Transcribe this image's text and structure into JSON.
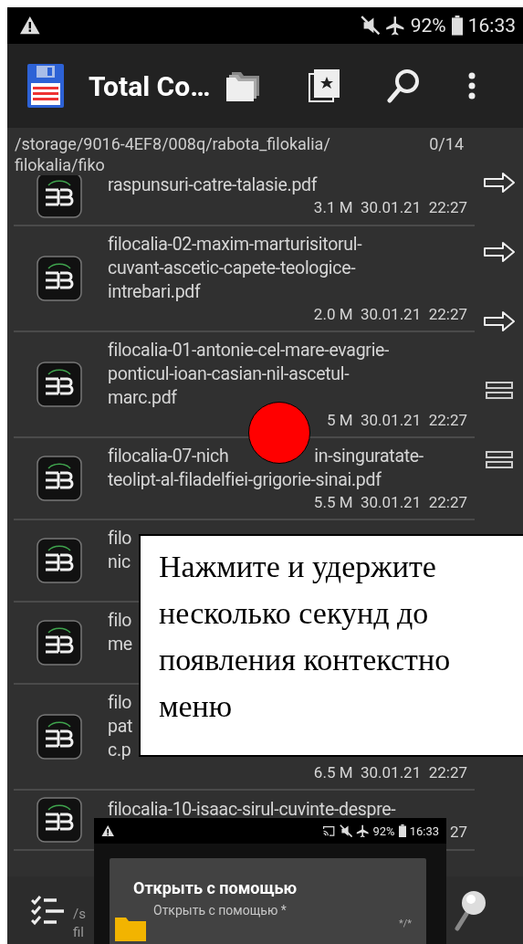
{
  "status_bar": {
    "battery": "92%",
    "time": "16:33"
  },
  "toolbar": {
    "title": "Total Co…"
  },
  "path_bar": {
    "path_lines": [
      "/storage/9016-4EF8/008q/rabota_filokalia/",
      "filokalia/fiko"
    ],
    "count": "0/14"
  },
  "files": [
    {
      "name_lines": [
        [
          "raspunsuri-catre-talasie.pdf"
        ]
      ],
      "meta": "3.1 M  30.01.21  22:27"
    },
    {
      "name_lines": [
        [
          "filocalia-02-maxim-marturisitorul-"
        ],
        [
          "cuvant-ascetic-capete-teologice-"
        ],
        [
          "intrebari.pdf"
        ]
      ],
      "meta": "2.0 M  30.01.21  22:27"
    },
    {
      "name_lines": [
        [
          "filocalia-01-antonie-cel-mare-evagrie-"
        ],
        [
          "ponticul-ioan-casian-nil-ascetul-"
        ],
        [
          "marc.pdf"
        ]
      ],
      "meta": "5 M  30.01.21  22:27"
    },
    {
      "name_lines": [
        [
          "filocalia-07-nich",
          "in-singuratate-"
        ],
        [
          "teolipt-al-filadelfiei-grigorie-sinai.pdf"
        ]
      ],
      "meta": "5.5 M  30.01.21  22:27"
    },
    {
      "name_lines": [
        [
          "filo"
        ],
        [
          "nic"
        ]
      ]
    },
    {
      "name_lines": [
        [
          "filo"
        ],
        [
          "me"
        ]
      ]
    },
    {
      "name_lines": [
        [
          "filo"
        ],
        [
          "pat"
        ],
        [
          "c.p"
        ]
      ],
      "meta": "6.5 M  30.01.21  22:27"
    },
    {
      "name_lines": [
        [
          "filocalia-10-isaac-sirul-cuvinte-despre-"
        ]
      ],
      "meta": "27"
    }
  ],
  "side_buttons": [
    {
      "kind": "arrow"
    },
    {
      "kind": "arrow"
    },
    {
      "kind": "arrow"
    },
    {
      "kind": "equals"
    },
    {
      "kind": "equals"
    }
  ],
  "bottom_bar": {
    "path_lines": [
      "/s",
      "fil"
    ]
  },
  "callout": {
    "lines": [
      "Нажмите и удержите",
      "несколько секунд до",
      "появления контекстно",
      "меню"
    ]
  },
  "inset": {
    "status_bar": {
      "battery": "92%",
      "time": "16:33"
    },
    "dialog": {
      "title": "Открыть с помощью",
      "item": "Открыть с помощью *",
      "item_type": "*/*"
    }
  }
}
